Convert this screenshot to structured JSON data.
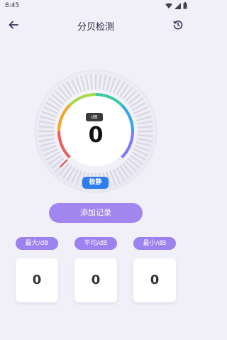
{
  "status_bar": {
    "time": "8:45"
  },
  "header": {
    "title": "分贝检测",
    "back_icon": "arrow-left-icon",
    "history_icon": "history-clock-icon"
  },
  "meter": {
    "unit": "dB",
    "value": "0",
    "level_label": "极静",
    "gauge_colors": [
      "#f05a5a",
      "#f5a623",
      "#a8d84a",
      "#3cc9a0",
      "#2fa6f0",
      "#7a7af5"
    ]
  },
  "actions": {
    "add_record": "添加记录"
  },
  "stats": [
    {
      "label": "最大/dB",
      "value": "0"
    },
    {
      "label": "平均/dB",
      "value": "0"
    },
    {
      "label": "最小/dB",
      "value": "0"
    }
  ],
  "colors": {
    "background": "#f1f0f8",
    "accent": "#a286f0",
    "badge_blue": "#2e7cf0"
  }
}
